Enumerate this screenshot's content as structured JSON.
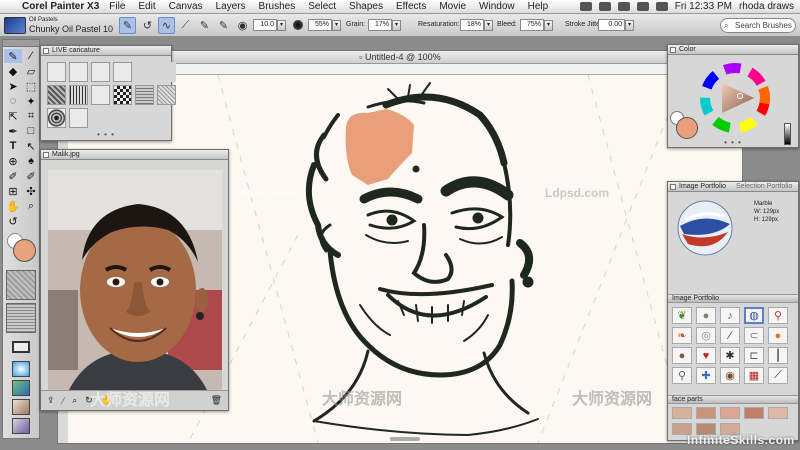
{
  "menubar": {
    "app_name": "Corel Painter X3",
    "items": [
      "File",
      "Edit",
      "Canvas",
      "Layers",
      "Brushes",
      "Select",
      "Shapes",
      "Effects",
      "Movie",
      "Window",
      "Help"
    ],
    "clock": "Fri 12:33 PM",
    "user": "rhoda draws"
  },
  "propbar": {
    "brush_category": "Oil Pastels",
    "brush_variant": "Chunky Oil Pastel 10",
    "size_value": "10.0",
    "opacity_value": "55%",
    "grain_label": "Grain:",
    "grain_value": "17%",
    "resaturation_label": "Resaturation:",
    "resaturation_value": "18%",
    "bleed_label": "Bleed:",
    "bleed_value": "75%",
    "stroke_jitter_label": "Stroke Jitter:",
    "stroke_jitter_value": "0.00",
    "search_placeholder": "Search Brushes"
  },
  "document": {
    "title": "Untitled-4 @ 100%"
  },
  "palettes": {
    "live_caricature": "LIVE caricature",
    "photo_title": "Malik.jpg",
    "color_title": "Color",
    "image_portfolio_tab": "Image Portfolio",
    "selection_portfolio_tab": "Selection Portfolio",
    "preview_name": "Marble",
    "preview_width": "W: 129px",
    "preview_height": "H: 129px",
    "portfolio_section": "Image Portfolio",
    "face_parts_section": "face parts"
  },
  "watermarks": {
    "infinite": "InfiniteSkills.com",
    "ldpsd": "Ldpsd.com",
    "cn": "大师资源网"
  },
  "colors": {
    "main_color": "#e9a07a",
    "canvas_bg": "#fdf8f1",
    "selection_blue": "#a9c1e8"
  },
  "icons": {
    "apple": "",
    "search": "⌕"
  }
}
